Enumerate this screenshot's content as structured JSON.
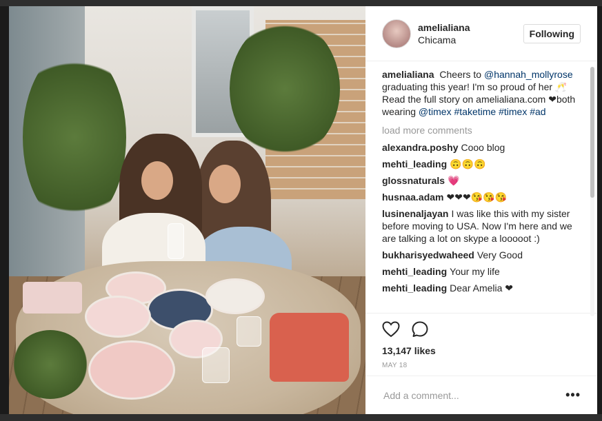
{
  "post": {
    "username": "amelialiana",
    "location": "Chicama",
    "follow_label": "Following",
    "photo_alt": "Two women toasting drinks at an outdoor cafe table"
  },
  "caption": {
    "user": "amelialiana",
    "text_1": "Cheers to",
    "mention_1": "@hannah_mollyrose",
    "text_2": "graduating this year! I'm so proud of her 🥂Read the full story on amelialiana.com ❤both wearing",
    "mention_2": "@timex",
    "tag_1": "#taketime",
    "tag_2": "#timex",
    "tag_3": "#ad"
  },
  "load_more": "load more comments",
  "comments": [
    {
      "user": "alexandra.poshy",
      "text": "Cooo blog"
    },
    {
      "user": "mehti_leading",
      "text": "🙃🙃🙃"
    },
    {
      "user": "glossnaturals",
      "text": "💗"
    },
    {
      "user": "husnaa.adam",
      "text": "❤❤❤😘😘😘"
    },
    {
      "user": "lusinenaljayan",
      "text": "I was like this with my sister before moving to USA. Now I'm here and we are talking a lot on skype a looooot :)"
    },
    {
      "user": "bukharisyedwaheed",
      "text": "Very Good"
    },
    {
      "user": "mehti_leading",
      "text": "Your my life"
    },
    {
      "user": "mehti_leading",
      "text": "Dear Amelia ❤"
    }
  ],
  "likes": "13,147 likes",
  "date": "MAY 18",
  "add_comment_placeholder": "Add a comment...",
  "more_label": "•••",
  "icons": [
    "heart-icon",
    "comment-icon",
    "more-options-icon"
  ]
}
